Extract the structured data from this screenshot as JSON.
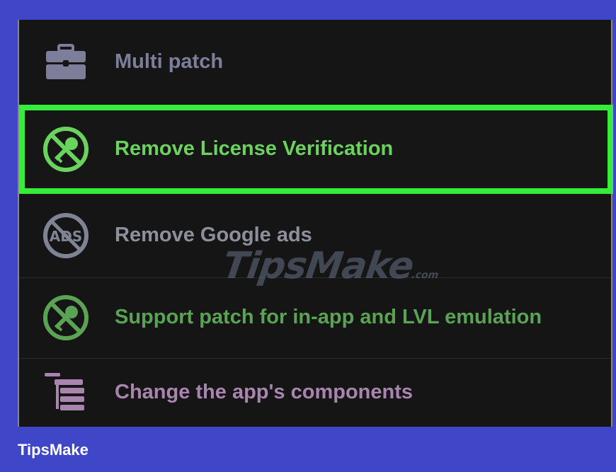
{
  "menu": {
    "items": [
      {
        "label": "Multi patch",
        "icon": "toolbox-icon",
        "color": "#7d7f9a"
      },
      {
        "label": "Remove License Verification",
        "icon": "no-key-icon",
        "color": "#6ad35d",
        "highlighted": true
      },
      {
        "label": "Remove Google ads",
        "icon": "no-ads-icon",
        "color": "#8e8f9c"
      },
      {
        "label": "Support patch for in-app and LVL emulation",
        "icon": "no-key-icon",
        "color": "#5aa354"
      },
      {
        "label": "Change the app's components",
        "icon": "components-icon",
        "color": "#a884ae"
      }
    ],
    "highlight_color": "#35ed3a"
  },
  "watermark": {
    "text": "TipsMake",
    "suffix": ".com"
  },
  "footer": {
    "brand": "TipsMake"
  },
  "colors": {
    "background": "#3f47c8",
    "panel": "#151515"
  }
}
